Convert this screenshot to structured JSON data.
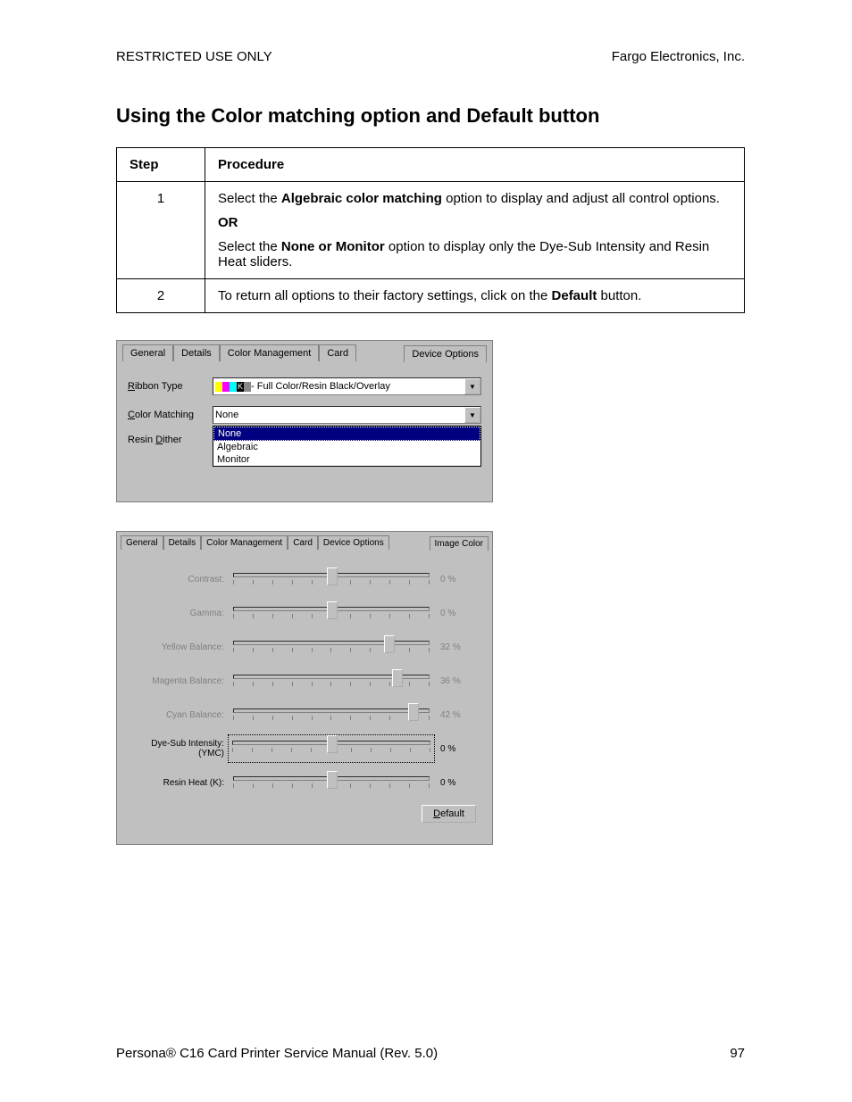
{
  "header": {
    "left": "RESTRICTED USE ONLY",
    "right": "Fargo Electronics, Inc."
  },
  "title": "Using the Color matching option and Default button",
  "table": {
    "head": [
      "Step",
      "Procedure"
    ],
    "rows": [
      {
        "step": "1",
        "proc": {
          "p1a": "Select the ",
          "p1b": "Algebraic color matching",
          "p1c": " option to display and adjust all control options.",
          "or": "OR",
          "p2a": "Select the ",
          "p2b": "None or Monitor",
          "p2c": " option to display only the Dye-Sub Intensity and Resin Heat sliders."
        }
      },
      {
        "step": "2",
        "proc": {
          "p1a": "To return all options to their factory settings, click on the ",
          "p1b": "Default",
          "p1c": " button."
        }
      }
    ]
  },
  "panel1": {
    "tabs": [
      "General",
      "Details",
      "Color Management",
      "Card",
      "Device Options"
    ],
    "ribbon_label": "Ribbon Type",
    "ribbon_value": " - Full Color/Resin Black/Overlay",
    "color_label": "Color Matching",
    "color_value": "None",
    "resin_label": "Resin Dither",
    "options": [
      "None",
      "Algebraic",
      "Monitor"
    ]
  },
  "panel2": {
    "tabs": [
      "General",
      "Details",
      "Color Management",
      "Card",
      "Device Options",
      "Image Color"
    ],
    "sliders": [
      {
        "label": "Contrast:",
        "val": "0  %",
        "pos": 50,
        "disabled": true
      },
      {
        "label": "Gamma:",
        "val": "0  %",
        "pos": 50,
        "disabled": true
      },
      {
        "label": "Yellow Balance:",
        "val": "32  %",
        "pos": 78,
        "disabled": true
      },
      {
        "label": "Magenta Balance:",
        "val": "36  %",
        "pos": 82,
        "disabled": true
      },
      {
        "label": "Cyan Balance:",
        "val": "42  %",
        "pos": 90,
        "disabled": true
      },
      {
        "label": "Dye-Sub Intensity: (YMC)",
        "val": "0  %",
        "pos": 50,
        "disabled": false,
        "focus": true
      },
      {
        "label": "Resin Heat  (K):",
        "val": "0  %",
        "pos": 50,
        "disabled": false
      }
    ],
    "default_btn": "Default"
  },
  "footer": {
    "left": "Persona® C16 Card Printer Service Manual (Rev. 5.0)",
    "right": "97"
  }
}
